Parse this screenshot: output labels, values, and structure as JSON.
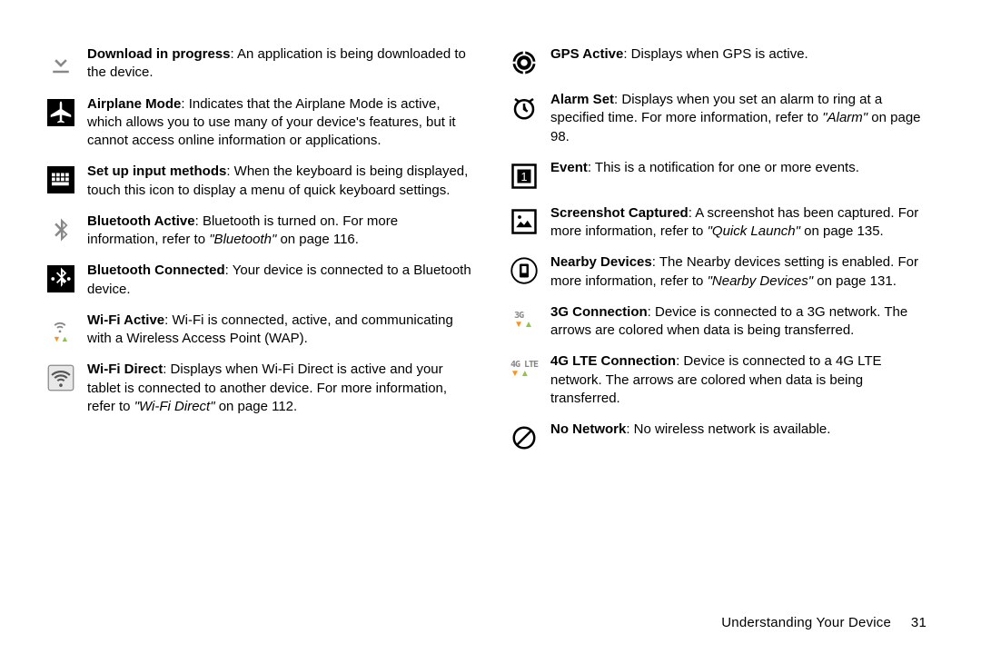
{
  "left": [
    {
      "icon": "download-icon",
      "title": "Download in progress",
      "text": ": An application is being downloaded to the device."
    },
    {
      "icon": "airplane-icon",
      "title": "Airplane Mode",
      "text": ": Indicates that the Airplane Mode is active, which allows you to use many of your device's features, but it cannot access online information or applications."
    },
    {
      "icon": "keyboard-icon",
      "title": "Set up input methods",
      "text": ": When the keyboard is being displayed, touch this icon to display a menu of quick keyboard settings."
    },
    {
      "icon": "bluetooth-icon",
      "title": "Bluetooth Active",
      "text": ": Bluetooth is turned on. For more information, refer to ",
      "ref": "\"Bluetooth\"",
      "tail": " on page 116."
    },
    {
      "icon": "bluetooth-connected-icon",
      "title": "Bluetooth Connected",
      "text": ": Your device is connected to a Bluetooth device."
    },
    {
      "icon": "wifi-active-icon",
      "title": "Wi-Fi Active",
      "text": ": Wi-Fi is connected, active, and communicating with a Wireless Access Point (WAP)."
    },
    {
      "icon": "wifi-direct-icon",
      "title": "Wi-Fi Direct",
      "text": ": Displays when Wi-Fi Direct is active and your tablet is connected to another device. For more information, refer to ",
      "ref": "\"Wi-Fi Direct\"",
      "tail": " on page 112."
    }
  ],
  "right": [
    {
      "icon": "gps-icon",
      "title": "GPS Active",
      "text": ": Displays when GPS is active."
    },
    {
      "icon": "alarm-icon",
      "title": "Alarm Set",
      "text": ": Displays when you set an alarm to ring at a specified time. For more information, refer to ",
      "ref": "\"Alarm\"",
      "tail": " on page 98."
    },
    {
      "icon": "event-icon",
      "title": "Event",
      "text": ": This is a notification for one or more events."
    },
    {
      "icon": "screenshot-icon",
      "title": "Screenshot Captured",
      "text": ": A screenshot has been captured. For more information, refer to ",
      "ref": "\"Quick Launch\"",
      "tail": " on page 135."
    },
    {
      "icon": "nearby-icon",
      "title": "Nearby Devices",
      "text": ": The Nearby devices setting is enabled. For more information, refer to ",
      "ref": "\"Nearby Devices\"",
      "tail": " on page 131."
    },
    {
      "icon": "threeg-icon",
      "title": "3G Connection",
      "text": ": Device is connected to a 3G network. The arrows are colored when data is being transferred."
    },
    {
      "icon": "fourg-icon",
      "title": "4G LTE Connection",
      "text": ": Device is connected to a 4G LTE network. The arrows are colored when data is being transferred."
    },
    {
      "icon": "nonetwork-icon",
      "title": "No Network",
      "text": ": No wireless network is available."
    }
  ],
  "footer": {
    "section": "Understanding Your Device",
    "page": "31"
  },
  "netlabels": {
    "threeg": "3G",
    "fourg": "4G LTE"
  }
}
